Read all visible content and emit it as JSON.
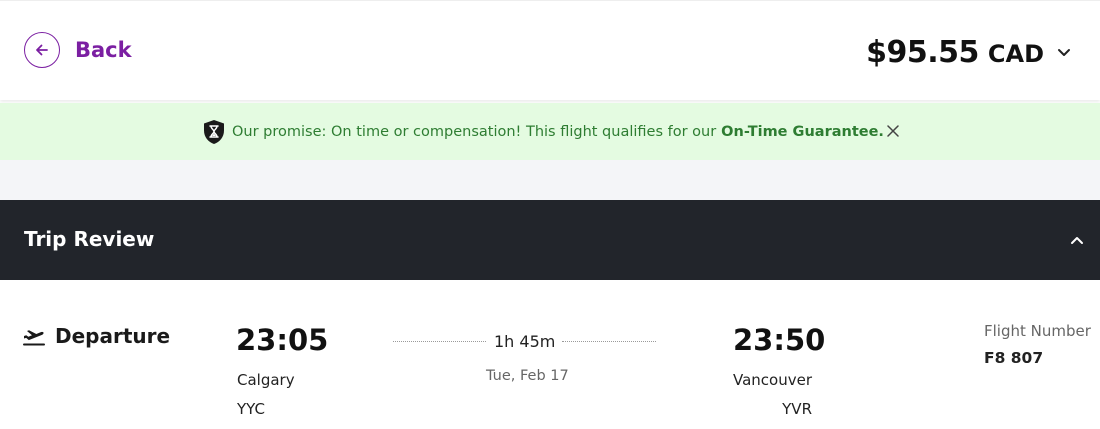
{
  "header": {
    "back_label": "Back",
    "price_amount": "$95.55",
    "price_currency": "CAD"
  },
  "promise": {
    "text": "Our promise: On time or compensation! This flight qualifies for our",
    "strong": "On-Time Guarantee."
  },
  "trip_review": {
    "title": "Trip Review"
  },
  "departure": {
    "label": "Departure",
    "depart_time": "23:05",
    "depart_city": "Calgary",
    "depart_code": "YYC",
    "duration": "1h 45m",
    "date": "Tue, Feb 17",
    "arrive_time": "23:50",
    "arrive_city": "Vancouver",
    "arrive_code": "YVR",
    "flight_number_label": "Flight Number",
    "flight_number": "F8 807"
  },
  "colors": {
    "accent_purple": "#7b1fa2",
    "promise_bg": "#e4fbe1",
    "promise_text": "#2e7d32",
    "trip_bar_bg": "#22252b"
  },
  "icons": {
    "back": "arrow-left-icon",
    "price_toggle": "chevron-down-icon",
    "promise": "shield-hourglass-icon",
    "close": "close-icon",
    "collapse": "chevron-up-icon",
    "departure": "plane-takeoff-icon"
  }
}
